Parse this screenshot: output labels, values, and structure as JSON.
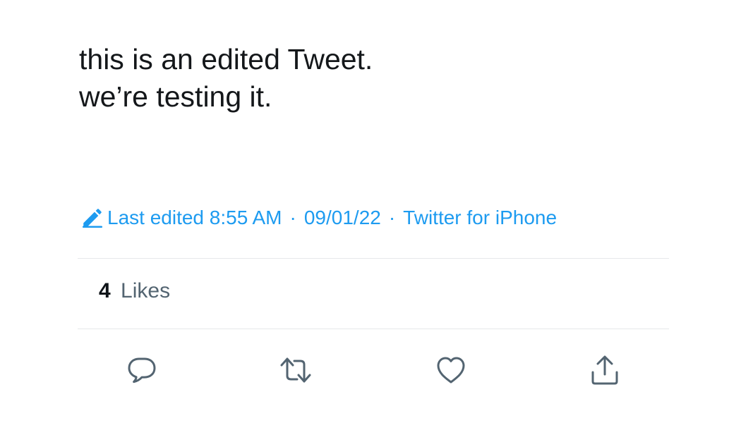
{
  "tweet": {
    "text_lines": [
      "this is an edited Tweet.",
      "we’re testing it."
    ]
  },
  "meta": {
    "edited_label": "Last edited 8:55 AM",
    "separator": "·",
    "date": "09/01/22",
    "source": "Twitter for iPhone",
    "accent_color": "#1d9bf0"
  },
  "stats": {
    "likes_count": "4",
    "likes_label": "Likes"
  },
  "actions": [
    {
      "icon": "reply-icon"
    },
    {
      "icon": "retweet-icon"
    },
    {
      "icon": "like-heart-icon"
    },
    {
      "icon": "share-icon"
    }
  ],
  "colors": {
    "text": "#14171a",
    "secondary_text": "#536471",
    "icon": "#536471",
    "divider": "#e6e8ea"
  }
}
